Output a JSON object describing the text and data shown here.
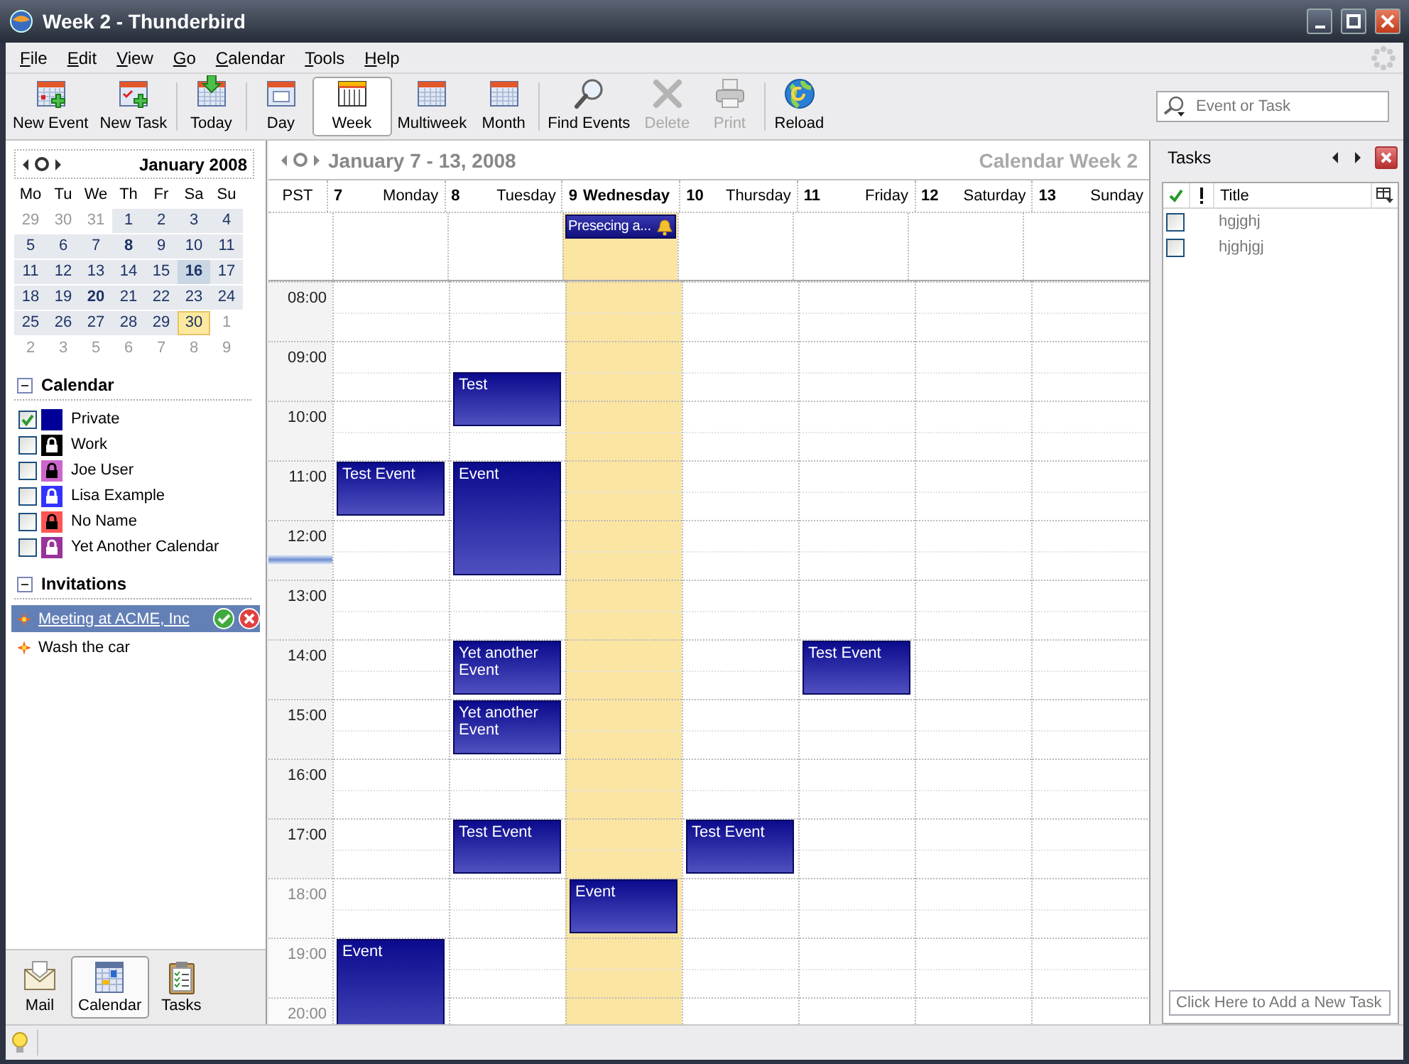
{
  "window": {
    "title": "Week 2 - Thunderbird"
  },
  "menu": [
    "File",
    "Edit",
    "View",
    "Go",
    "Calendar",
    "Tools",
    "Help"
  ],
  "toolbar": [
    [
      {
        "kind": "new-event",
        "label": "New Event",
        "selected": false,
        "disabled": false
      },
      {
        "kind": "new-task",
        "label": "New Task",
        "selected": false,
        "disabled": false
      }
    ],
    [
      {
        "kind": "today",
        "label": "Today",
        "selected": false,
        "disabled": false
      }
    ],
    [
      {
        "kind": "day",
        "label": "Day",
        "selected": false,
        "disabled": false
      },
      {
        "kind": "week",
        "label": "Week",
        "selected": true,
        "disabled": false
      },
      {
        "kind": "multiweek",
        "label": "Multiweek",
        "selected": false,
        "disabled": false
      },
      {
        "kind": "month",
        "label": "Month",
        "selected": false,
        "disabled": false
      }
    ],
    [
      {
        "kind": "find",
        "label": "Find Events",
        "selected": false,
        "disabled": false
      },
      {
        "kind": "delete",
        "label": "Delete",
        "selected": false,
        "disabled": true
      },
      {
        "kind": "print",
        "label": "Print",
        "selected": false,
        "disabled": true
      }
    ],
    [
      {
        "kind": "reload",
        "label": "Reload",
        "selected": false,
        "disabled": false
      }
    ]
  ],
  "search": {
    "placeholder": "Event or Task"
  },
  "minimonth": {
    "title": "January 2008",
    "weekdays": [
      "Mo",
      "Tu",
      "We",
      "Th",
      "Fr",
      "Sa",
      "Su"
    ],
    "weeks": [
      [
        {
          "d": "29",
          "outside": true,
          "busy": false,
          "selected": false,
          "today": false
        },
        {
          "d": "30",
          "outside": true,
          "busy": false,
          "selected": false,
          "today": false
        },
        {
          "d": "31",
          "outside": true,
          "busy": false,
          "selected": false,
          "today": false
        },
        {
          "d": "1",
          "outside": false,
          "busy": false,
          "selected": false,
          "today": false
        },
        {
          "d": "2",
          "outside": false,
          "busy": false,
          "selected": false,
          "today": false
        },
        {
          "d": "3",
          "outside": false,
          "busy": false,
          "selected": false,
          "today": false
        },
        {
          "d": "4",
          "outside": false,
          "busy": false,
          "selected": false,
          "today": false
        }
      ],
      [
        {
          "d": "5",
          "outside": false,
          "busy": false,
          "selected": false,
          "today": false
        },
        {
          "d": "6",
          "outside": false,
          "busy": false,
          "selected": false,
          "today": false
        },
        {
          "d": "7",
          "outside": false,
          "busy": false,
          "selected": false,
          "today": false
        },
        {
          "d": "8",
          "outside": false,
          "busy": true,
          "selected": false,
          "today": false
        },
        {
          "d": "9",
          "outside": false,
          "busy": false,
          "selected": false,
          "today": false
        },
        {
          "d": "10",
          "outside": false,
          "busy": false,
          "selected": false,
          "today": false
        },
        {
          "d": "11",
          "outside": false,
          "busy": false,
          "selected": false,
          "today": false
        }
      ],
      [
        {
          "d": "11",
          "outside": false,
          "busy": false,
          "selected": false,
          "today": false
        },
        {
          "d": "12",
          "outside": false,
          "busy": false,
          "selected": false,
          "today": false
        },
        {
          "d": "13",
          "outside": false,
          "busy": false,
          "selected": false,
          "today": false
        },
        {
          "d": "14",
          "outside": false,
          "busy": false,
          "selected": false,
          "today": false
        },
        {
          "d": "15",
          "outside": false,
          "busy": false,
          "selected": false,
          "today": false
        },
        {
          "d": "16",
          "outside": false,
          "busy": true,
          "selected": true,
          "today": false
        },
        {
          "d": "17",
          "outside": false,
          "busy": false,
          "selected": false,
          "today": false
        }
      ],
      [
        {
          "d": "18",
          "outside": false,
          "busy": false,
          "selected": false,
          "today": false
        },
        {
          "d": "19",
          "outside": false,
          "busy": false,
          "selected": false,
          "today": false
        },
        {
          "d": "20",
          "outside": false,
          "busy": true,
          "selected": false,
          "today": false
        },
        {
          "d": "21",
          "outside": false,
          "busy": false,
          "selected": false,
          "today": false
        },
        {
          "d": "22",
          "outside": false,
          "busy": false,
          "selected": false,
          "today": false
        },
        {
          "d": "23",
          "outside": false,
          "busy": false,
          "selected": false,
          "today": false
        },
        {
          "d": "24",
          "outside": false,
          "busy": false,
          "selected": false,
          "today": false
        }
      ],
      [
        {
          "d": "25",
          "outside": false,
          "busy": false,
          "selected": false,
          "today": false
        },
        {
          "d": "26",
          "outside": false,
          "busy": false,
          "selected": false,
          "today": false
        },
        {
          "d": "27",
          "outside": false,
          "busy": false,
          "selected": false,
          "today": false
        },
        {
          "d": "28",
          "outside": false,
          "busy": false,
          "selected": false,
          "today": false
        },
        {
          "d": "29",
          "outside": false,
          "busy": false,
          "selected": false,
          "today": false
        },
        {
          "d": "30",
          "outside": false,
          "busy": false,
          "selected": false,
          "today": true
        },
        {
          "d": "1",
          "outside": true,
          "busy": false,
          "selected": false,
          "today": false
        }
      ],
      [
        {
          "d": "2",
          "outside": true,
          "busy": false,
          "selected": false,
          "today": false
        },
        {
          "d": "3",
          "outside": true,
          "busy": false,
          "selected": false,
          "today": false
        },
        {
          "d": "5",
          "outside": true,
          "busy": false,
          "selected": false,
          "today": false
        },
        {
          "d": "6",
          "outside": true,
          "busy": false,
          "selected": false,
          "today": false
        },
        {
          "d": "7",
          "outside": true,
          "busy": false,
          "selected": false,
          "today": false
        },
        {
          "d": "8",
          "outside": true,
          "busy": false,
          "selected": false,
          "today": false
        },
        {
          "d": "9",
          "outside": true,
          "busy": false,
          "selected": false,
          "today": false
        }
      ]
    ]
  },
  "calendars": {
    "title": "Calendar",
    "expanded": true,
    "items": [
      {
        "name": "Private",
        "checked": true,
        "color": "#000099",
        "locked": false
      },
      {
        "name": "Work",
        "checked": false,
        "color": "#000000",
        "locked": true
      },
      {
        "name": "Joe User",
        "checked": false,
        "color": "#cc66cc",
        "locked": true
      },
      {
        "name": "Lisa Example",
        "checked": false,
        "color": "#3333ff",
        "locked": true
      },
      {
        "name": "No Name",
        "checked": false,
        "color": "#ff5555",
        "locked": true
      },
      {
        "name": "Yet Another Calendar",
        "checked": false,
        "color": "#993399",
        "locked": true
      }
    ]
  },
  "invitations": {
    "title": "Invitations",
    "expanded": true,
    "items": [
      {
        "title": "Meeting at ACME, Inc",
        "selected": true
      },
      {
        "title": "Wash the car",
        "selected": false
      }
    ]
  },
  "modes": [
    {
      "kind": "mail",
      "label": "Mail",
      "selected": false
    },
    {
      "kind": "calendar",
      "label": "Calendar",
      "selected": true
    },
    {
      "kind": "tasks",
      "label": "Tasks",
      "selected": false
    }
  ],
  "view": {
    "range": "January 7 - 13, 2008",
    "week_label": "Calendar Week 2",
    "timezone": "PST",
    "hours": [
      {
        "label": "08:00",
        "working": true
      },
      {
        "label": "09:00",
        "working": true
      },
      {
        "label": "10:00",
        "working": true
      },
      {
        "label": "11:00",
        "working": true
      },
      {
        "label": "12:00",
        "working": true
      },
      {
        "label": "13:00",
        "working": true
      },
      {
        "label": "14:00",
        "working": true
      },
      {
        "label": "15:00",
        "working": true
      },
      {
        "label": "16:00",
        "working": true
      },
      {
        "label": "17:00",
        "working": true
      },
      {
        "label": "18:00",
        "working": false
      },
      {
        "label": "19:00",
        "working": false
      },
      {
        "label": "20:00",
        "working": false
      }
    ],
    "days": [
      {
        "date": "7",
        "name": "Monday",
        "selected": false,
        "events": [
          {
            "title": "Test Event"
          },
          {
            "title": "Event"
          }
        ]
      },
      {
        "date": "8",
        "name": "Tuesday",
        "selected": false,
        "events": [
          {
            "title": "Test"
          },
          {
            "title": "Event"
          },
          {
            "title": "Yet another Event"
          },
          {
            "title": "Yet another Event"
          },
          {
            "title": "Test Event"
          }
        ]
      },
      {
        "date": "9",
        "name": "Wednesday",
        "selected": true,
        "all_day": [
          {
            "title": "Presecing a...",
            "alarm": true
          }
        ],
        "events": [
          {
            "title": "Event"
          }
        ]
      },
      {
        "date": "10",
        "name": "Thursday",
        "selected": false,
        "events": [
          {
            "title": "Test Event"
          }
        ]
      },
      {
        "date": "11",
        "name": "Friday",
        "selected": false,
        "events": [
          {
            "title": "Test Event"
          }
        ]
      },
      {
        "date": "12",
        "name": "Saturday",
        "selected": false
      },
      {
        "date": "13",
        "name": "Sunday",
        "selected": false
      }
    ]
  },
  "tasks": {
    "title": "Tasks",
    "column": "Title",
    "rows": [
      {
        "title": "hgjghj",
        "done": false
      },
      {
        "title": "hjghjgj",
        "done": false
      }
    ],
    "new_task": {
      "placeholder": "Click Here to Add a New Task"
    }
  }
}
